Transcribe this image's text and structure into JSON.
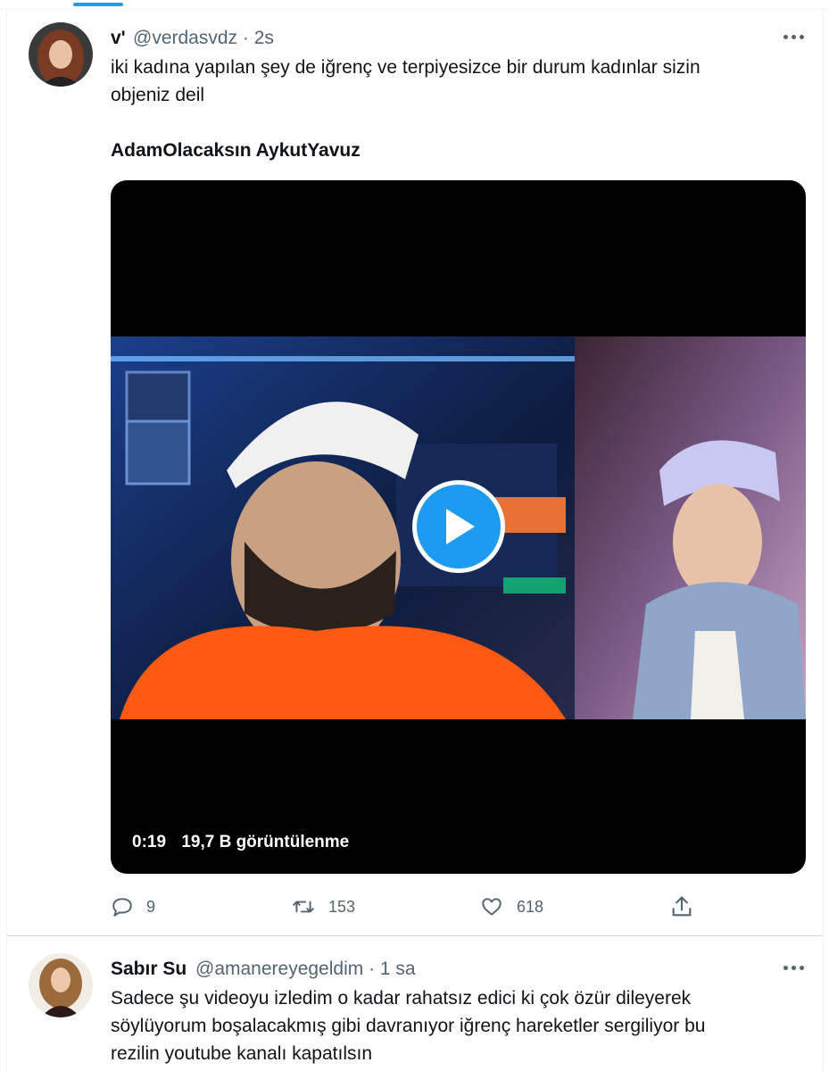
{
  "tweet1": {
    "name": "v'",
    "handle_time": "@verdasvdz · 2s",
    "text_line1": "iki kadına yapılan şey de iğrenç ve terpiyesizce bir durum kadınlar sizin",
    "text_line2": "objeniz deil",
    "hashtags": "AdamOlacaksın AykutYavuz",
    "video": {
      "duration": "0:19",
      "views": "19,7 B görüntülenme"
    },
    "actions": {
      "replies": "9",
      "retweets": "153",
      "likes": "618"
    }
  },
  "tweet2": {
    "name": "Sabır Su",
    "handle_time": "@amanereyegeldim · 1 sa",
    "text_line1": "Sadece şu videoyu izledim o kadar rahatsız edici ki çok özür dileyerek",
    "text_line2": "söylüyorum boşalacakmış gibi davranıyor iğrenç hareketler sergiliyor bu",
    "text_line3": "rezilin youtube kanalı kapatılsın"
  },
  "icons": [
    "more-icon",
    "reply-icon",
    "retweet-icon",
    "like-icon",
    "share-icon",
    "play-icon"
  ],
  "colors": {
    "accent": "#1d9bf0",
    "muted": "#536471",
    "text": "#0f1419"
  }
}
